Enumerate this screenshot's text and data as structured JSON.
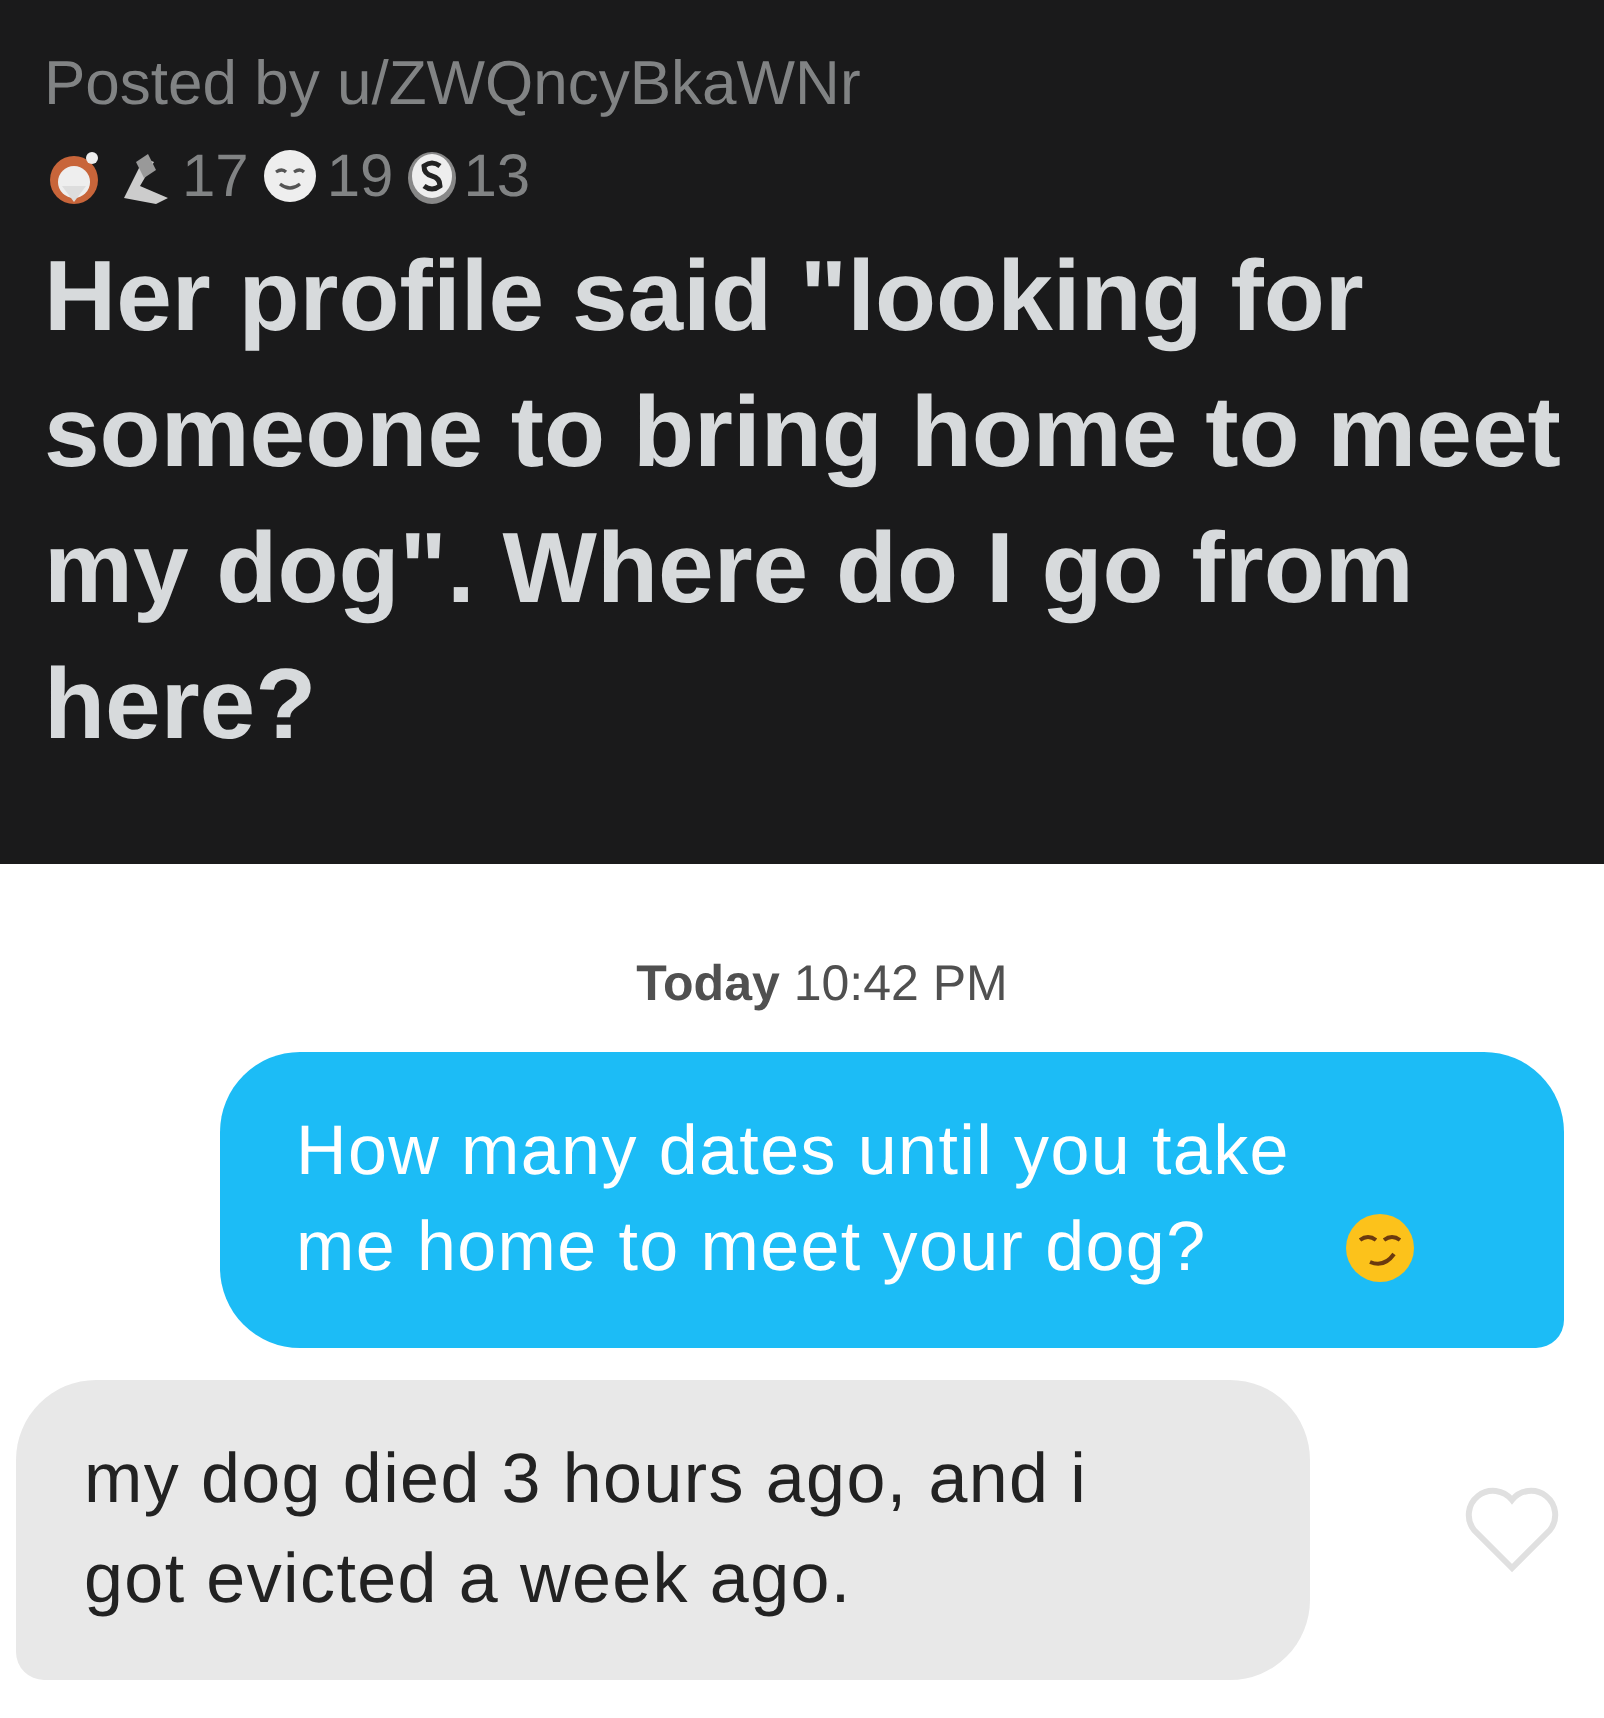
{
  "post": {
    "posted_by": "Posted by u/ZWQncyBkaWNr",
    "awards": [
      {
        "kind": "laugh"
      },
      {
        "kind": "hands",
        "count": "17"
      },
      {
        "kind": "smile",
        "count": "19"
      },
      {
        "kind": "coin",
        "count": "13"
      }
    ],
    "title": "Her profile said \"looking for someone to bring home to meet my dog\". Where do I go from here?"
  },
  "chat": {
    "date_label": "Today",
    "time": "10:42 PM",
    "messages": [
      {
        "kind": "sent",
        "text": "How many dates until you take me home to meet your dog?",
        "emoji": true
      },
      {
        "kind": "received",
        "text": "my dog died 3 hours ago, and i got evicted a week ago.",
        "liked": false
      }
    ]
  }
}
